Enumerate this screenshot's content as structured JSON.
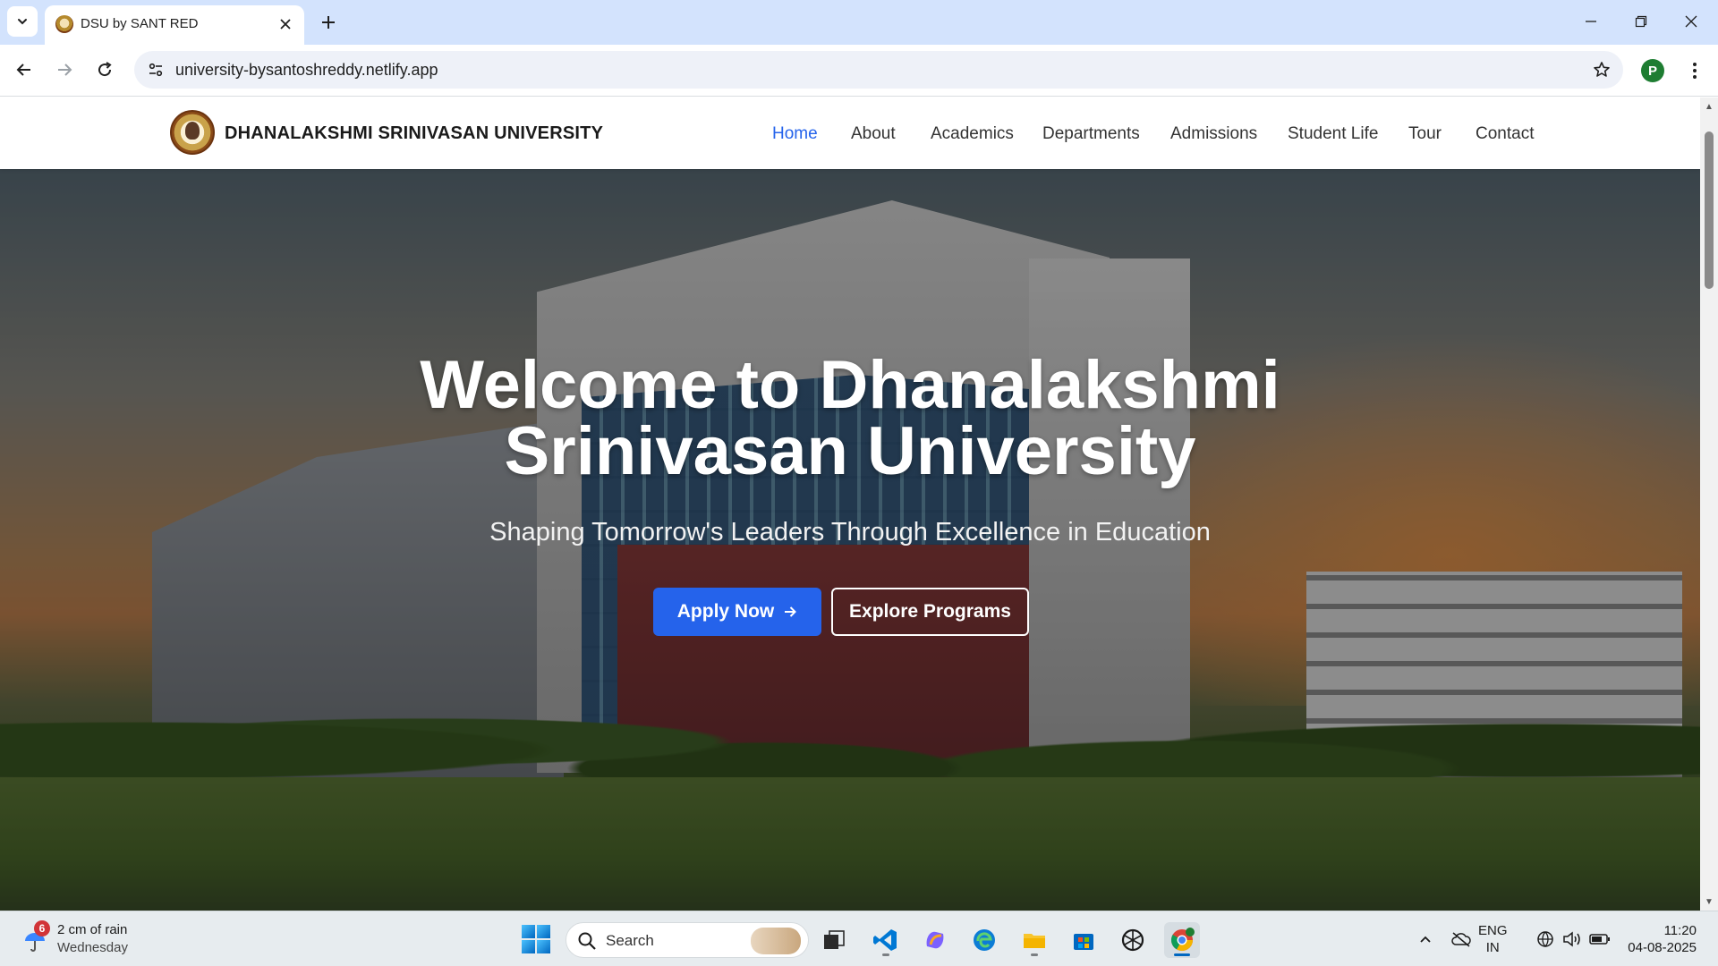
{
  "browser": {
    "tab_title": "DSU by SANT RED",
    "url": "university-bysantoshreddy.netlify.app",
    "profile_initial": "P",
    "icons": {
      "tab_list": "chevron-down-icon",
      "close_tab": "close-icon",
      "new_tab": "plus-icon",
      "back": "arrow-left-icon",
      "forward": "arrow-right-icon",
      "reload": "reload-icon",
      "site_info": "tune-icon",
      "bookmark": "star-icon",
      "menu": "more-vertical-icon"
    }
  },
  "site": {
    "name": "DHANALAKSHMI SRINIVASAN UNIVERSITY",
    "nav": [
      {
        "label": "Home",
        "active": true
      },
      {
        "label": "About",
        "active": false
      },
      {
        "label": "Academics",
        "active": false
      },
      {
        "label": "Departments",
        "active": false
      },
      {
        "label": "Admissions",
        "active": false
      },
      {
        "label": "Student Life",
        "active": false
      },
      {
        "label": "Tour",
        "active": false
      },
      {
        "label": "Contact",
        "active": false
      }
    ],
    "accent_color": "#2563eb"
  },
  "hero": {
    "title_line1": "Welcome to Dhanalakshmi",
    "title_line2": "Srinivasan University",
    "subtitle": "Shaping Tomorrow's Leaders Through Excellence in Education",
    "primary_button": "Apply Now",
    "primary_button_icon": "arrow-right-icon",
    "secondary_button": "Explore Programs"
  },
  "taskbar": {
    "weather": {
      "badge": "6",
      "text": "2 cm of rain",
      "day": "Wednesday"
    },
    "search_label": "Search",
    "apps": [
      "start-icon",
      "task-view-icon",
      "vscode-icon",
      "copilot-icon",
      "edge-icon",
      "file-explorer-icon",
      "store-icon",
      "chatgpt-icon",
      "chrome-icon"
    ],
    "language_line1": "ENG",
    "language_line2": "IN",
    "time": "11:20",
    "date": "04-08-2025"
  }
}
